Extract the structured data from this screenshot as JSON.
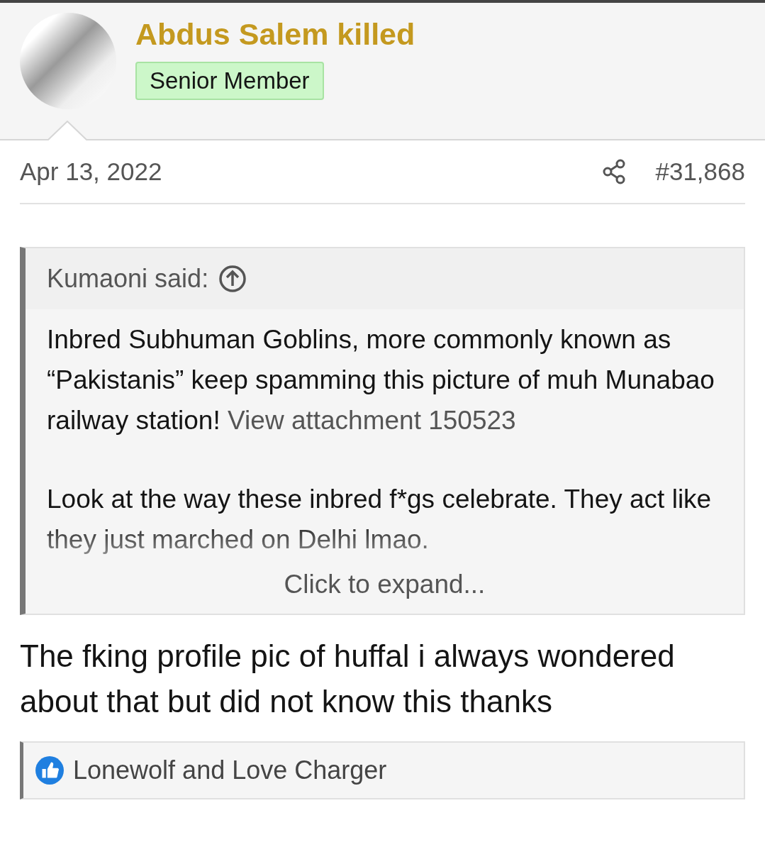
{
  "user": {
    "name": "Abdus Salem killed",
    "title": "Senior Member"
  },
  "post": {
    "date": "Apr 13, 2022",
    "number": "#31,868"
  },
  "quote": {
    "author": "Kumaoni said:",
    "paragraphs": [
      {
        "text": "Inbred Subhuman Goblins, more commonly known as “Pakistanis” keep spamming this picture of muh Munabao railway station!",
        "link": "View attachment 150523"
      },
      {
        "text": "Look at the way these inbred f*gs celebrate. They act like they just marched on Delhi lmao."
      }
    ],
    "expand": "Click to expand..."
  },
  "message": "The fking profile pic of huffal i always wondered about that but did not know this thanks",
  "reactions": "Lonewolf and Love Charger"
}
